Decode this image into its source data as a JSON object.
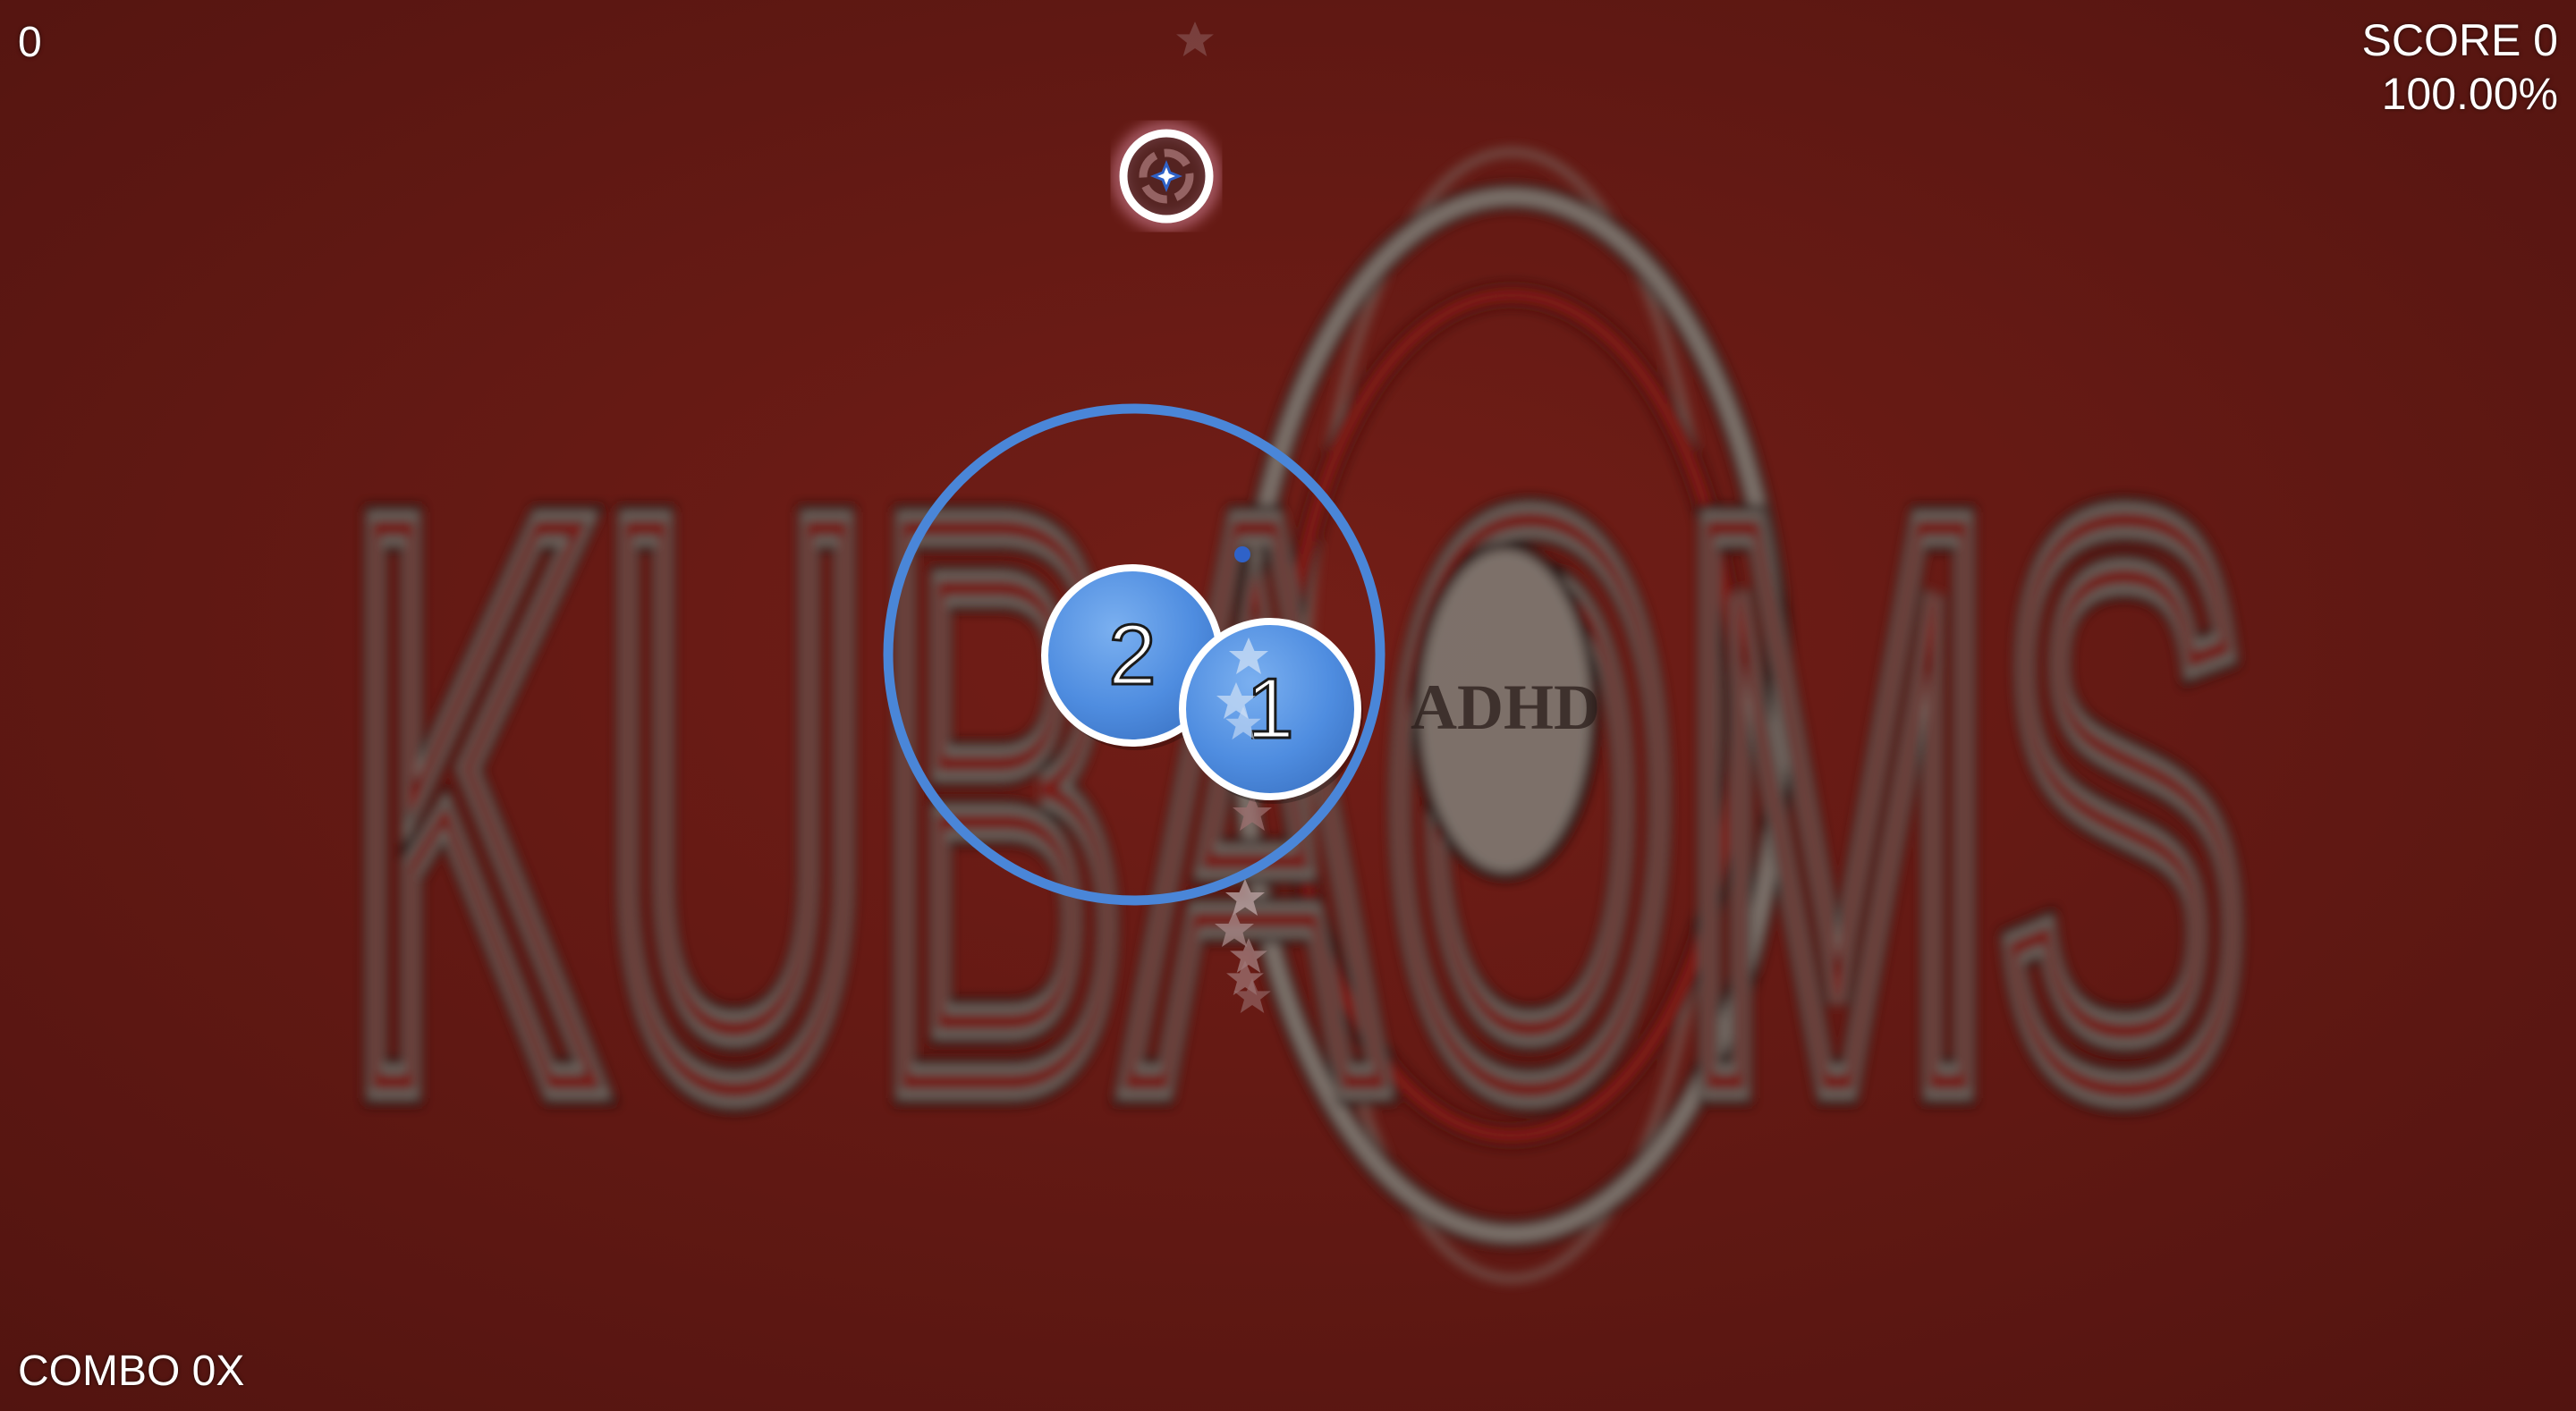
{
  "hud": {
    "counter": "0",
    "score": "SCORE 0",
    "accuracy": "100.00%",
    "combo": "COMBO 0X"
  },
  "background": {
    "logo_text": "KUBAOMS",
    "badge_text": "ADHD",
    "colors": {
      "base": "#5e1712",
      "logo_fill": "#7f7a73",
      "logo_stroke": "#161010",
      "logo_red": "#8a1f17"
    }
  },
  "playfield": {
    "approach_circle_color": "#4a86d8",
    "hit_circle_color": "#4f8de0",
    "hit_circle_border": "#ffffff",
    "circles": [
      {
        "label": "2"
      },
      {
        "label": "1"
      }
    ],
    "cursor_icon": "cursor-crosshair-icon",
    "trail_icon": "star-icon"
  }
}
